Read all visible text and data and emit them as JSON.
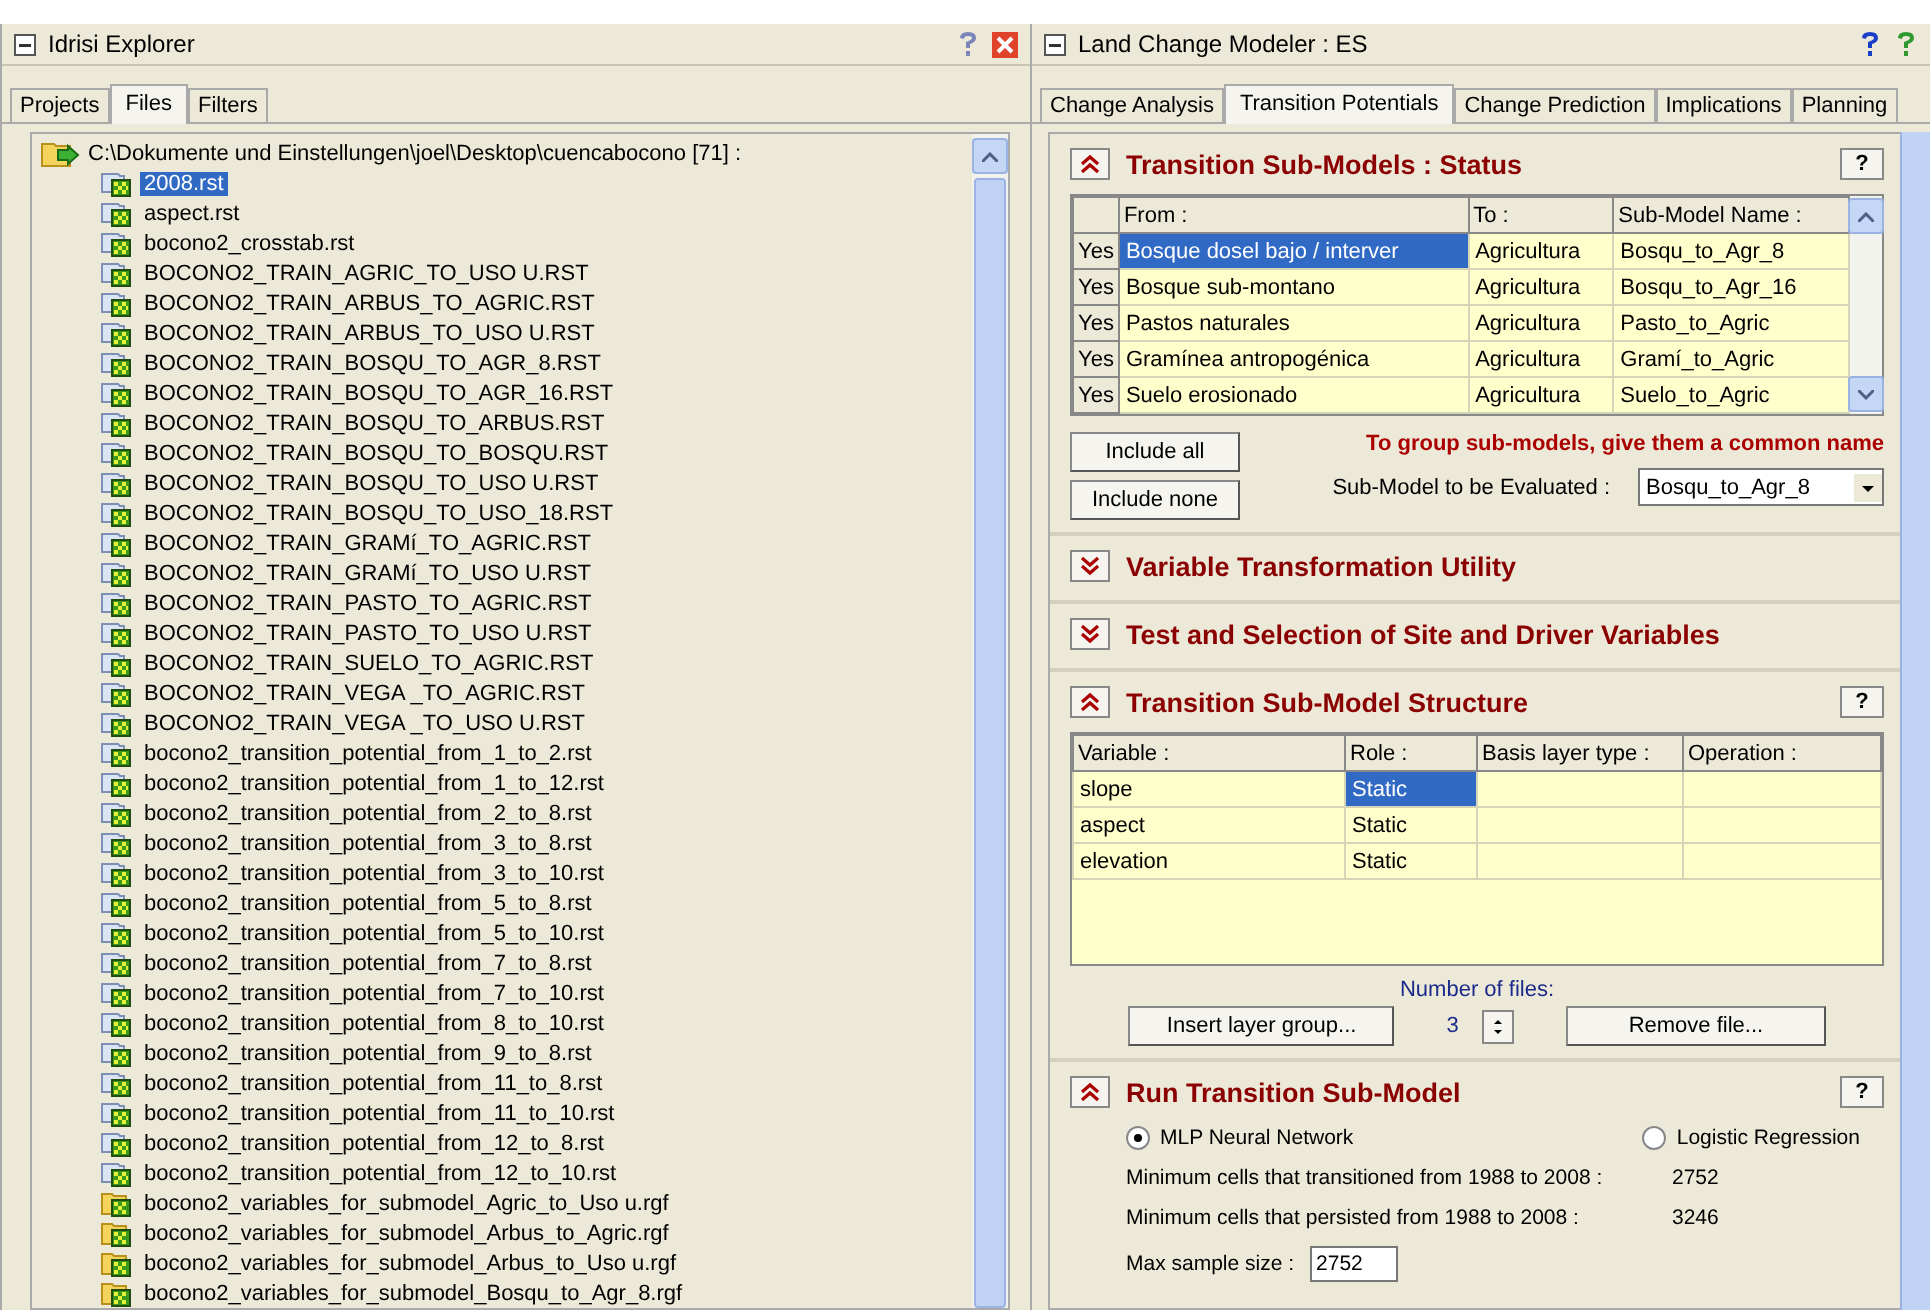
{
  "explorer": {
    "title": "Idrisi Explorer",
    "tabs": [
      {
        "label": "Projects",
        "selected": false
      },
      {
        "label": "Files",
        "selected": true
      },
      {
        "label": "Filters",
        "selected": false
      }
    ],
    "folder": "C:\\Dokumente und Einstellungen\\joel\\Desktop\\cuencabocono [71] :",
    "files": [
      {
        "name": "2008.rst",
        "kind": "raster",
        "selected": true
      },
      {
        "name": "aspect.rst",
        "kind": "raster",
        "selected": false
      },
      {
        "name": "bocono2_crosstab.rst",
        "kind": "raster",
        "selected": false
      },
      {
        "name": "BOCONO2_TRAIN_AGRIC_TO_USO U.RST",
        "kind": "raster",
        "selected": false
      },
      {
        "name": "BOCONO2_TRAIN_ARBUS_TO_AGRIC.RST",
        "kind": "raster",
        "selected": false
      },
      {
        "name": "BOCONO2_TRAIN_ARBUS_TO_USO U.RST",
        "kind": "raster",
        "selected": false
      },
      {
        "name": "BOCONO2_TRAIN_BOSQU_TO_AGR_8.RST",
        "kind": "raster",
        "selected": false
      },
      {
        "name": "BOCONO2_TRAIN_BOSQU_TO_AGR_16.RST",
        "kind": "raster",
        "selected": false
      },
      {
        "name": "BOCONO2_TRAIN_BOSQU_TO_ARBUS.RST",
        "kind": "raster",
        "selected": false
      },
      {
        "name": "BOCONO2_TRAIN_BOSQU_TO_BOSQU.RST",
        "kind": "raster",
        "selected": false
      },
      {
        "name": "BOCONO2_TRAIN_BOSQU_TO_USO U.RST",
        "kind": "raster",
        "selected": false
      },
      {
        "name": "BOCONO2_TRAIN_BOSQU_TO_USO_18.RST",
        "kind": "raster",
        "selected": false
      },
      {
        "name": "BOCONO2_TRAIN_GRAMí_TO_AGRIC.RST",
        "kind": "raster",
        "selected": false
      },
      {
        "name": "BOCONO2_TRAIN_GRAMí_TO_USO U.RST",
        "kind": "raster",
        "selected": false
      },
      {
        "name": "BOCONO2_TRAIN_PASTO_TO_AGRIC.RST",
        "kind": "raster",
        "selected": false
      },
      {
        "name": "BOCONO2_TRAIN_PASTO_TO_USO U.RST",
        "kind": "raster",
        "selected": false
      },
      {
        "name": "BOCONO2_TRAIN_SUELO_TO_AGRIC.RST",
        "kind": "raster",
        "selected": false
      },
      {
        "name": "BOCONO2_TRAIN_VEGA _TO_AGRIC.RST",
        "kind": "raster",
        "selected": false
      },
      {
        "name": "BOCONO2_TRAIN_VEGA _TO_USO U.RST",
        "kind": "raster",
        "selected": false
      },
      {
        "name": "bocono2_transition_potential_from_1_to_2.rst",
        "kind": "raster",
        "selected": false
      },
      {
        "name": "bocono2_transition_potential_from_1_to_12.rst",
        "kind": "raster",
        "selected": false
      },
      {
        "name": "bocono2_transition_potential_from_2_to_8.rst",
        "kind": "raster",
        "selected": false
      },
      {
        "name": "bocono2_transition_potential_from_3_to_8.rst",
        "kind": "raster",
        "selected": false
      },
      {
        "name": "bocono2_transition_potential_from_3_to_10.rst",
        "kind": "raster",
        "selected": false
      },
      {
        "name": "bocono2_transition_potential_from_5_to_8.rst",
        "kind": "raster",
        "selected": false
      },
      {
        "name": "bocono2_transition_potential_from_5_to_10.rst",
        "kind": "raster",
        "selected": false
      },
      {
        "name": "bocono2_transition_potential_from_7_to_8.rst",
        "kind": "raster",
        "selected": false
      },
      {
        "name": "bocono2_transition_potential_from_7_to_10.rst",
        "kind": "raster",
        "selected": false
      },
      {
        "name": "bocono2_transition_potential_from_8_to_10.rst",
        "kind": "raster",
        "selected": false
      },
      {
        "name": "bocono2_transition_potential_from_9_to_8.rst",
        "kind": "raster",
        "selected": false
      },
      {
        "name": "bocono2_transition_potential_from_11_to_8.rst",
        "kind": "raster",
        "selected": false
      },
      {
        "name": "bocono2_transition_potential_from_11_to_10.rst",
        "kind": "raster",
        "selected": false
      },
      {
        "name": "bocono2_transition_potential_from_12_to_8.rst",
        "kind": "raster",
        "selected": false
      },
      {
        "name": "bocono2_transition_potential_from_12_to_10.rst",
        "kind": "raster",
        "selected": false
      },
      {
        "name": "bocono2_variables_for_submodel_Agric_to_Uso u.rgf",
        "kind": "group",
        "selected": false
      },
      {
        "name": "bocono2_variables_for_submodel_Arbus_to_Agric.rgf",
        "kind": "group",
        "selected": false
      },
      {
        "name": "bocono2_variables_for_submodel_Arbus_to_Uso u.rgf",
        "kind": "group",
        "selected": false
      },
      {
        "name": "bocono2_variables_for_submodel_Bosqu_to_Agr_8.rgf",
        "kind": "group",
        "selected": false
      }
    ]
  },
  "modeler": {
    "title": "Land Change Modeler : ES",
    "tabs": [
      {
        "label": "Change Analysis",
        "selected": false
      },
      {
        "label": "Transition Potentials",
        "selected": true
      },
      {
        "label": "Change Prediction",
        "selected": false
      },
      {
        "label": "Implications",
        "selected": false
      },
      {
        "label": "Planning",
        "selected": false
      }
    ],
    "sections": [
      {
        "kind": "status",
        "title": "Transition Sub-Models : Status",
        "expanded": true,
        "help": "?",
        "columns": [
          "From :",
          "To :",
          "Sub-Model Name :"
        ],
        "rows": [
          {
            "include": "Yes",
            "cells": [
              "Bosque dosel bajo / interver",
              "Agricultura",
              "Bosqu_to_Agr_8"
            ],
            "selected": true
          },
          {
            "include": "Yes",
            "cells": [
              "Bosque sub-montano",
              "Agricultura",
              "Bosqu_to_Agr_16"
            ],
            "selected": false
          },
          {
            "include": "Yes",
            "cells": [
              "Pastos naturales",
              "Agricultura",
              "Pasto_to_Agric"
            ],
            "selected": false
          },
          {
            "include": "Yes",
            "cells": [
              "Gramínea antropogénica",
              "Agricultura",
              "Gramí_to_Agric"
            ],
            "selected": false
          },
          {
            "include": "Yes",
            "cells": [
              "Suelo erosionado",
              "Agricultura",
              "Suelo_to_Agric"
            ],
            "selected": false
          }
        ],
        "buttons": [
          "Include all",
          "Include none"
        ],
        "note": "To group sub-models, give them a common name",
        "evaluate_label": "Sub-Model to be Evaluated :",
        "evaluate_value": "Bosqu_to_Agr_8"
      },
      {
        "kind": "collapsed",
        "title": "Variable Transformation Utility",
        "expanded": false
      },
      {
        "kind": "collapsed",
        "title": "Test and Selection of Site and Driver Variables",
        "expanded": false
      },
      {
        "kind": "structure",
        "title": "Transition Sub-Model Structure",
        "expanded": true,
        "help": "?",
        "columns": [
          "Variable :",
          "Role :",
          "Basis layer type :",
          "Operation :"
        ],
        "rows": [
          {
            "cells": [
              "slope",
              "Static"
            ],
            "selected": true
          },
          {
            "cells": [
              "aspect",
              "Static"
            ],
            "selected": false
          },
          {
            "cells": [
              "elevation",
              "Static"
            ],
            "selected": false
          }
        ],
        "files_label": "Number of files:",
        "files_count": "3",
        "buttons": [
          "Insert layer group...",
          "Remove file..."
        ]
      },
      {
        "kind": "run",
        "title": "Run Transition Sub-Model",
        "expanded": true,
        "help": "?",
        "methods": [
          {
            "label": "MLP Neural Network",
            "selected": true
          },
          {
            "label": "Logistic Regression",
            "selected": false
          }
        ],
        "stats": [
          {
            "label": "Minimum cells that transitioned from 1988 to 2008 :",
            "value": "2752"
          },
          {
            "label": "Minimum cells that persisted from 1988 to 2008 :",
            "value": "3246"
          }
        ],
        "sample_label": "Max sample size :",
        "sample_value": "2752"
      }
    ]
  }
}
